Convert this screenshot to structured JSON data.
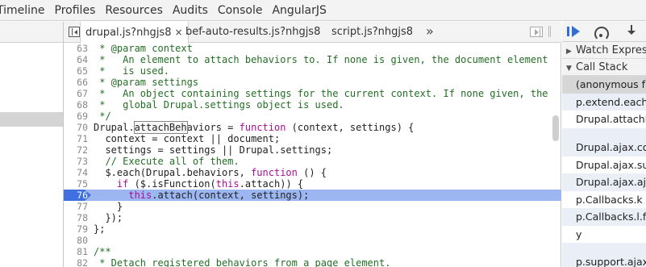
{
  "panel_tabs": [
    "Timeline",
    "Profiles",
    "Resources",
    "Audits",
    "Console",
    "AngularJS"
  ],
  "file_tabs": [
    {
      "label": "drupal.js?nhgjs8",
      "active": true,
      "close": "×"
    },
    {
      "label": "bef-auto-results.js?nhgjs8",
      "active": false
    },
    {
      "label": "script.js?nhgjs8",
      "active": false
    }
  ],
  "more_tabs": "»",
  "code": {
    "highlight_token": "attachBeh",
    "lines": [
      {
        "n": "63",
        "text": " * @param context",
        "type": "comment"
      },
      {
        "n": "64",
        "text": " *   An element to attach behaviors to. If none is given, the document element",
        "type": "comment"
      },
      {
        "n": "65",
        "text": " *   is used.",
        "type": "comment"
      },
      {
        "n": "66",
        "text": " * @param settings",
        "type": "comment"
      },
      {
        "n": "67",
        "text": " *   An object containing settings for the current context. If none given, the",
        "type": "comment"
      },
      {
        "n": "68",
        "text": " *   global Drupal.settings object is used.",
        "type": "comment"
      },
      {
        "n": "69",
        "text": " */",
        "type": "comment"
      },
      {
        "n": "70",
        "text": "Drupal.attachBehaviors = function (context, settings) {",
        "type": "code"
      },
      {
        "n": "71",
        "text": "  context = context || document;",
        "type": "code"
      },
      {
        "n": "72",
        "text": "  settings = settings || Drupal.settings;",
        "type": "code"
      },
      {
        "n": "73",
        "text": "  // Execute all of them.",
        "type": "comment"
      },
      {
        "n": "74",
        "text": "  $.each(Drupal.behaviors, function () {",
        "type": "code"
      },
      {
        "n": "75",
        "text": "    if ($.isFunction(this.attach)) {",
        "type": "code"
      },
      {
        "n": "76",
        "text": "      this.attach(context, settings);",
        "type": "code",
        "exec": true
      },
      {
        "n": "77",
        "text": "    }",
        "type": "code"
      },
      {
        "n": "78",
        "text": "  });",
        "type": "code"
      },
      {
        "n": "79",
        "text": "};",
        "type": "code"
      },
      {
        "n": "80",
        "text": "",
        "type": "code"
      },
      {
        "n": "81",
        "text": "/**",
        "type": "comment"
      },
      {
        "n": "82",
        "text": " * Detach registered behaviors from a page element.",
        "type": "comment"
      }
    ]
  },
  "sidebar": {
    "watch_label": "Watch Expressions",
    "watch_tri": "▶",
    "callstack_label": "Call Stack",
    "callstack_tri": "▼",
    "frames": [
      {
        "label": "(anonymous function)",
        "style": "selected"
      },
      {
        "label": "p.extend.each",
        "style": "normal"
      },
      {
        "label": "Drupal.attachBehaviors",
        "style": "plain"
      },
      {
        "label": "Drupal.ajax.commands.insert",
        "style": "tall"
      },
      {
        "label": "Drupal.ajax.success",
        "style": "plain"
      },
      {
        "label": "Drupal.ajax.ajax.options.success",
        "style": "normal"
      },
      {
        "label": "p.Callbacks.k",
        "style": "plain"
      },
      {
        "label": "p.Callbacks.l.fireWith",
        "style": "normal"
      },
      {
        "label": "y",
        "style": "plain"
      },
      {
        "label": "p.support.ajax.send",
        "style": "tall"
      }
    ]
  },
  "colors": {
    "exec_line": "#9cb6f2",
    "exec_marker": "#3f70e0",
    "comment": "#236e25",
    "keyword": "#aa0d91",
    "accent": "#2f6fd6"
  }
}
